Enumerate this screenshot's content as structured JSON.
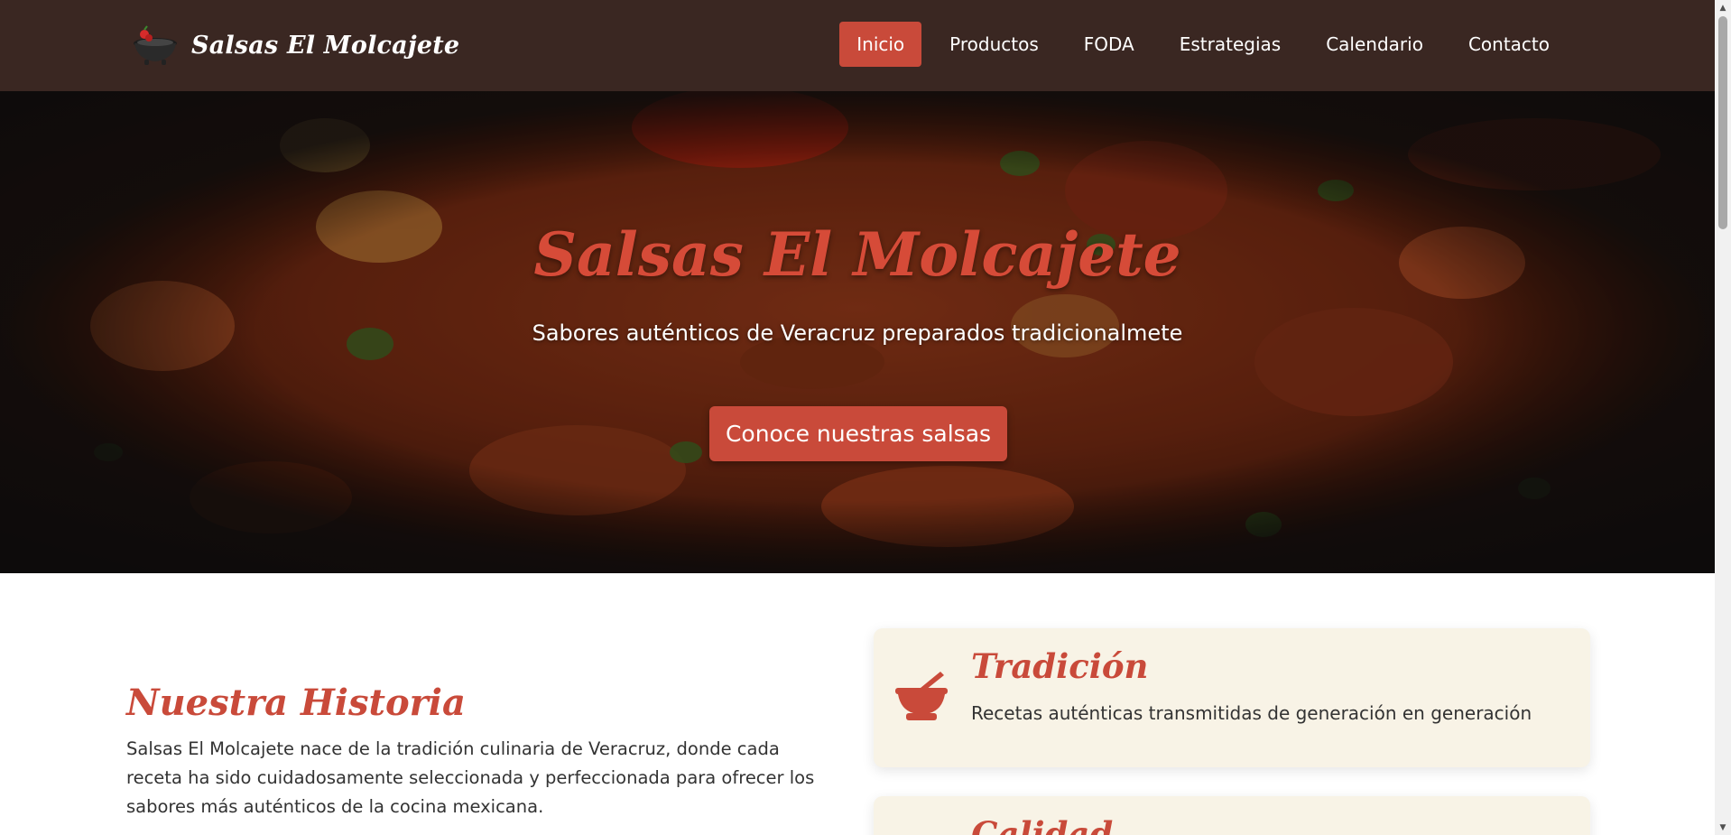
{
  "navbar": {
    "brand_name": "Salsas El Molcajete",
    "logo_icon": "molcajete-logo-icon",
    "links": [
      {
        "label": "Inicio",
        "active": true
      },
      {
        "label": "Productos",
        "active": false
      },
      {
        "label": "FODA",
        "active": false
      },
      {
        "label": "Estrategias",
        "active": false
      },
      {
        "label": "Calendario",
        "active": false
      },
      {
        "label": "Contacto",
        "active": false
      }
    ]
  },
  "hero": {
    "title": "Salsas El Molcajete",
    "subtitle": "Sabores auténticos de Veracruz preparados tradicionalmete",
    "cta_label": "Conoce nuestras salsas"
  },
  "story": {
    "title": "Nuestra Historia",
    "text": "Salsas El Molcajete nace de la tradición culinaria de Veracruz, donde cada receta ha sido cuidadosamente seleccionada y perfeccionada para ofrecer los sabores más auténticos de la cocina mexicana."
  },
  "features": [
    {
      "icon": "mortar-pestle-icon",
      "title": "Tradición",
      "text": "Recetas auténticas transmitidas de generación en generación"
    },
    {
      "icon": "",
      "title": "Calidad",
      "text": ""
    }
  ],
  "colors": {
    "navbar_bg": "#3a2722",
    "accent": "#c94a3a",
    "card_bg": "#f8f3e6"
  }
}
